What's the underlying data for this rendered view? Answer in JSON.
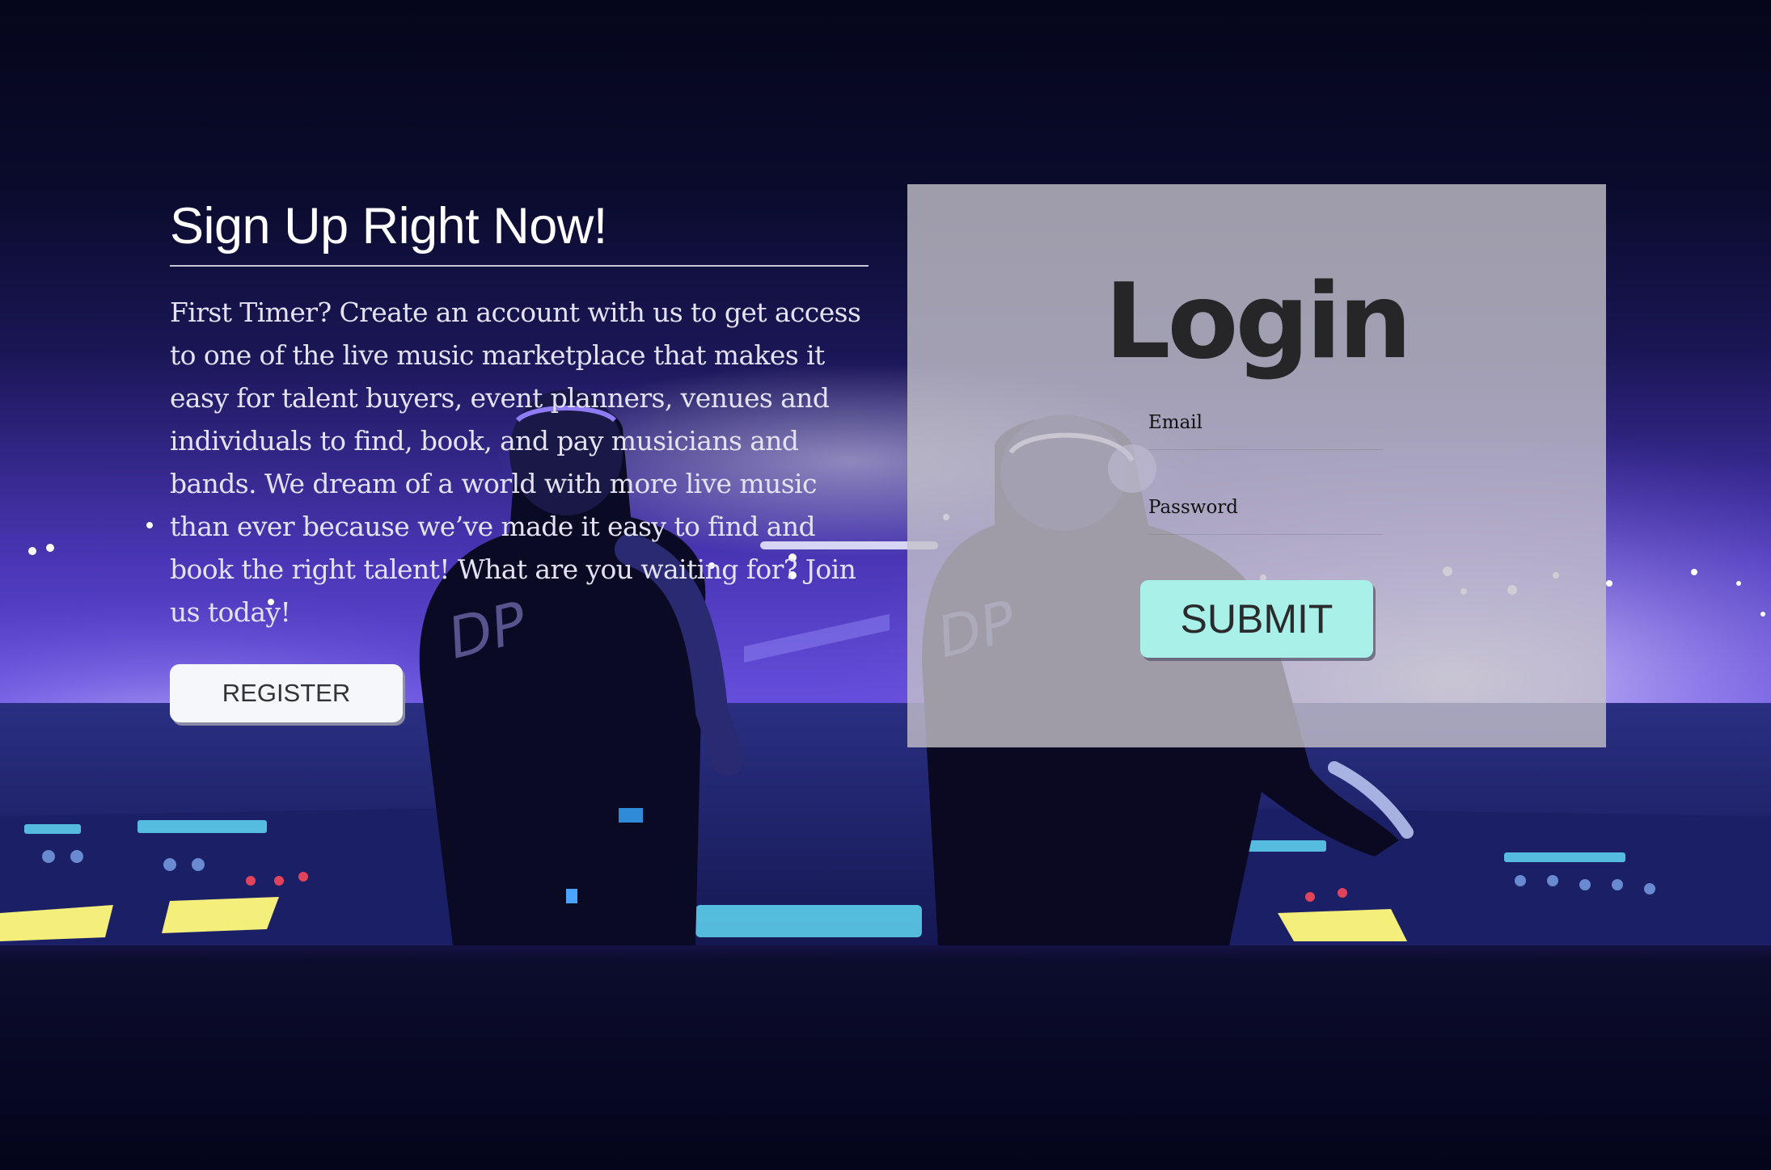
{
  "signup": {
    "title": "Sign Up Right Now!",
    "description": "First Timer? Create an account with us to get access to one of the live music marketplace that makes it easy for talent buyers, event planners, venues and individuals to find, book, and pay musicians and bands. We dream of a world with more live music than ever because we’ve made it easy to find and book the right talent! What are you waiting for? Join us today!",
    "register_label": "REGISTER"
  },
  "login": {
    "title": "Login",
    "email_label": "Email",
    "password_label": "Password",
    "submit_label": "SUBMIT"
  },
  "colors": {
    "page_background": "#05061a",
    "stage_purple": "#6a4fe0",
    "panel_background": "#c4c2cb",
    "submit_button": "#a8f0e8",
    "register_button": "#f6f7fb"
  }
}
